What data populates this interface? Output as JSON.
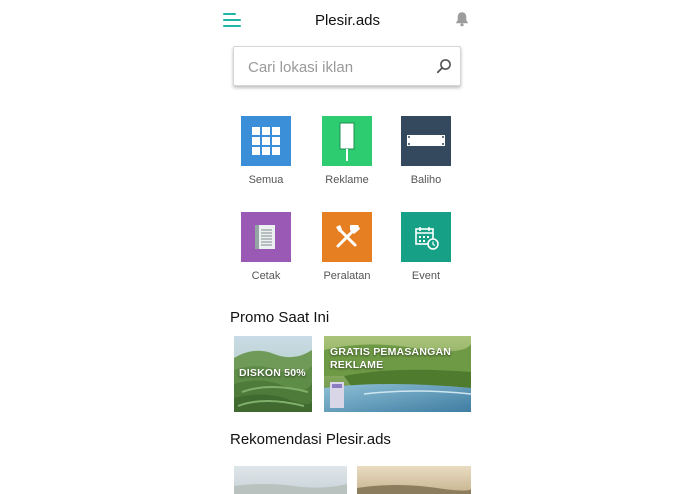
{
  "header": {
    "title": "Plesir.ads"
  },
  "search": {
    "placeholder": "Cari lokasi iklan"
  },
  "categories": [
    {
      "label": "Semua",
      "icon": "grid-icon",
      "color": "#3b8fd9"
    },
    {
      "label": "Reklame",
      "icon": "billboard-pole-icon",
      "color": "#2ecc71"
    },
    {
      "label": "Baliho",
      "icon": "banner-icon",
      "color": "#34495e"
    },
    {
      "label": "Cetak",
      "icon": "print-book-icon",
      "color": "#9b59b6"
    },
    {
      "label": "Peralatan",
      "icon": "tools-icon",
      "color": "#e67e22"
    },
    {
      "label": "Event",
      "icon": "calendar-clock-icon",
      "color": "#16a085"
    }
  ],
  "promo": {
    "title": "Promo Saat Ini",
    "cards": [
      {
        "text": "DISKON 50%"
      },
      {
        "text": "GRATIS PEMASANGAN REKLAME"
      }
    ]
  },
  "recommendations": {
    "title": "Rekomendasi Plesir.ads"
  },
  "colors": {
    "accent": "#1fb5a3"
  }
}
